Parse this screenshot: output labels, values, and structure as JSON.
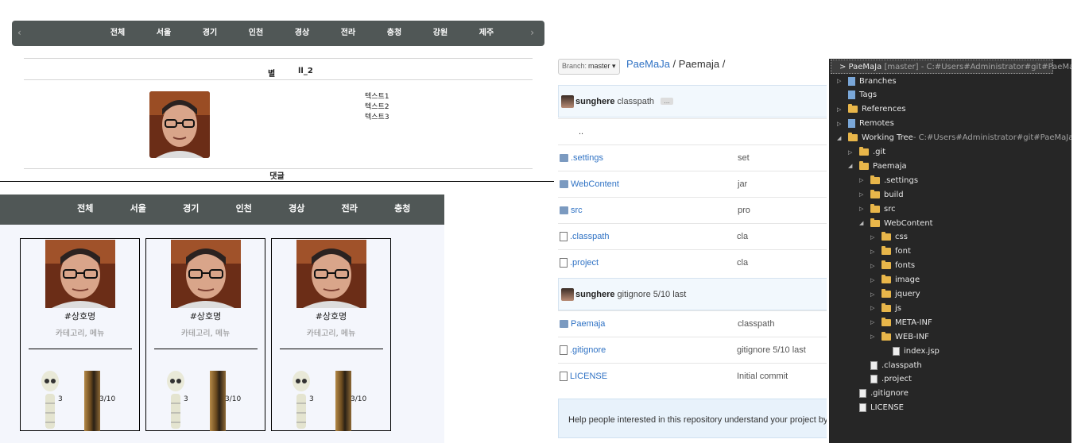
{
  "panel1": {
    "nav_prev": "‹",
    "nav_next": "›",
    "nav": [
      "전체",
      "서울",
      "경기",
      "인천",
      "경상",
      "전라",
      "충청",
      "강원",
      "제주"
    ],
    "title_left": "별",
    "title_right": "ll_2",
    "texts": [
      "텍스트1",
      "텍스트2",
      "텍스트3"
    ],
    "comment": "댓글"
  },
  "panel2": {
    "nav": [
      "전체",
      "서울",
      "경기",
      "인천",
      "경상",
      "전라",
      "충청"
    ],
    "cards": [
      {
        "name": "#상호명",
        "category": "카테고리, 메뉴",
        "count": "3",
        "ratio": "3/10"
      },
      {
        "name": "#상호명",
        "category": "카테고리, 메뉴",
        "count": "3",
        "ratio": "3/10"
      },
      {
        "name": "#상호명",
        "category": "카테고리, 메뉴",
        "count": "3",
        "ratio": "3/10"
      }
    ]
  },
  "github": {
    "branch_label": "Branch:",
    "branch_value": "master ▾",
    "repo": "PaeMaJa",
    "sep": " / ",
    "folder": "Paemaja",
    "tail": " /",
    "commit1": {
      "user": "sunghere",
      "message": "classpath",
      "more": "…"
    },
    "rows1": [
      {
        "name": "..",
        "comment": "",
        "type": "up"
      },
      {
        "name": ".settings",
        "comment": "set",
        "type": "dir"
      },
      {
        "name": "WebContent",
        "comment": "jar",
        "type": "dir"
      },
      {
        "name": "src",
        "comment": "pro",
        "type": "dir"
      },
      {
        "name": ".classpath",
        "comment": "cla",
        "type": "file"
      },
      {
        "name": ".project",
        "comment": "cla",
        "type": "file"
      }
    ],
    "commit2": {
      "user": "sunghere",
      "message": "gitignore 5/10 last"
    },
    "rows2": [
      {
        "name": "Paemaja",
        "comment": "classpath",
        "type": "dir"
      },
      {
        "name": ".gitignore",
        "comment": "gitignore 5/10 last",
        "type": "file"
      },
      {
        "name": "LICENSE",
        "comment": "Initial commit",
        "type": "file"
      }
    ],
    "help": "Help people interested in this repository understand your project by add"
  },
  "eclipse": {
    "root": "> PaeMaJa",
    "root_branch": "[master]",
    "root_path": "- C:#Users#Administrator#git#PaeMaJa#.git",
    "tree": [
      {
        "label": "Branches",
        "level": 0,
        "kind": "node",
        "exp": "▷"
      },
      {
        "label": "Tags",
        "level": 0,
        "kind": "node",
        "exp": ""
      },
      {
        "label": "References",
        "level": 0,
        "kind": "folder",
        "exp": "▷"
      },
      {
        "label": "Remotes",
        "level": 0,
        "kind": "node",
        "exp": "▷"
      },
      {
        "label": "Working Tree",
        "deco": " - C:#Users#Administrator#git#PaeMaJa",
        "level": 0,
        "kind": "folder",
        "exp": "◢"
      },
      {
        "label": ".git",
        "level": 1,
        "kind": "folder",
        "exp": "▷"
      },
      {
        "label": "Paemaja",
        "level": 1,
        "kind": "folder",
        "exp": "◢"
      },
      {
        "label": ".settings",
        "level": 2,
        "kind": "folder",
        "exp": "▷"
      },
      {
        "label": "build",
        "level": 2,
        "kind": "folder",
        "exp": "▷"
      },
      {
        "label": "src",
        "level": 2,
        "kind": "folder",
        "exp": "▷"
      },
      {
        "label": "WebContent",
        "level": 2,
        "kind": "folder",
        "exp": "◢"
      },
      {
        "label": "css",
        "level": 3,
        "kind": "folder",
        "exp": "▷"
      },
      {
        "label": "font",
        "level": 3,
        "kind": "folder",
        "exp": "▷"
      },
      {
        "label": "fonts",
        "level": 3,
        "kind": "folder",
        "exp": "▷"
      },
      {
        "label": "image",
        "level": 3,
        "kind": "folder",
        "exp": "▷"
      },
      {
        "label": "jquery",
        "level": 3,
        "kind": "folder",
        "exp": "▷"
      },
      {
        "label": "js",
        "level": 3,
        "kind": "folder",
        "exp": "▷"
      },
      {
        "label": "META-INF",
        "level": 3,
        "kind": "folder",
        "exp": "▷"
      },
      {
        "label": "WEB-INF",
        "level": 3,
        "kind": "folder",
        "exp": "▷"
      },
      {
        "label": "index.jsp",
        "level": 4,
        "kind": "file",
        "exp": ""
      },
      {
        "label": ".classpath",
        "level": 2,
        "kind": "file",
        "exp": ""
      },
      {
        "label": ".project",
        "level": 2,
        "kind": "file",
        "exp": ""
      },
      {
        "label": ".gitignore",
        "level": 1,
        "kind": "file",
        "exp": ""
      },
      {
        "label": "LICENSE",
        "level": 1,
        "kind": "file",
        "exp": ""
      }
    ]
  }
}
